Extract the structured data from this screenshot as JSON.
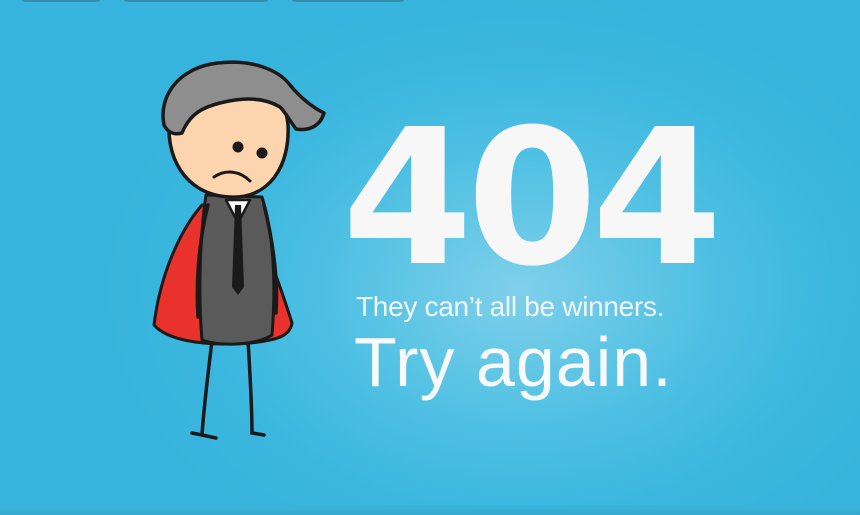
{
  "error": {
    "code": "404",
    "message": "They can’t all be winners.",
    "cta": "Try again."
  },
  "illustration": {
    "icon": "sad-caped-man-icon"
  },
  "colors": {
    "background": "#3bb7df",
    "text": "#f7f7f7",
    "cape": "#e8322b",
    "suit": "#5a5a5a",
    "hair": "#8e8e8e",
    "skin": "#fcd4ae"
  }
}
